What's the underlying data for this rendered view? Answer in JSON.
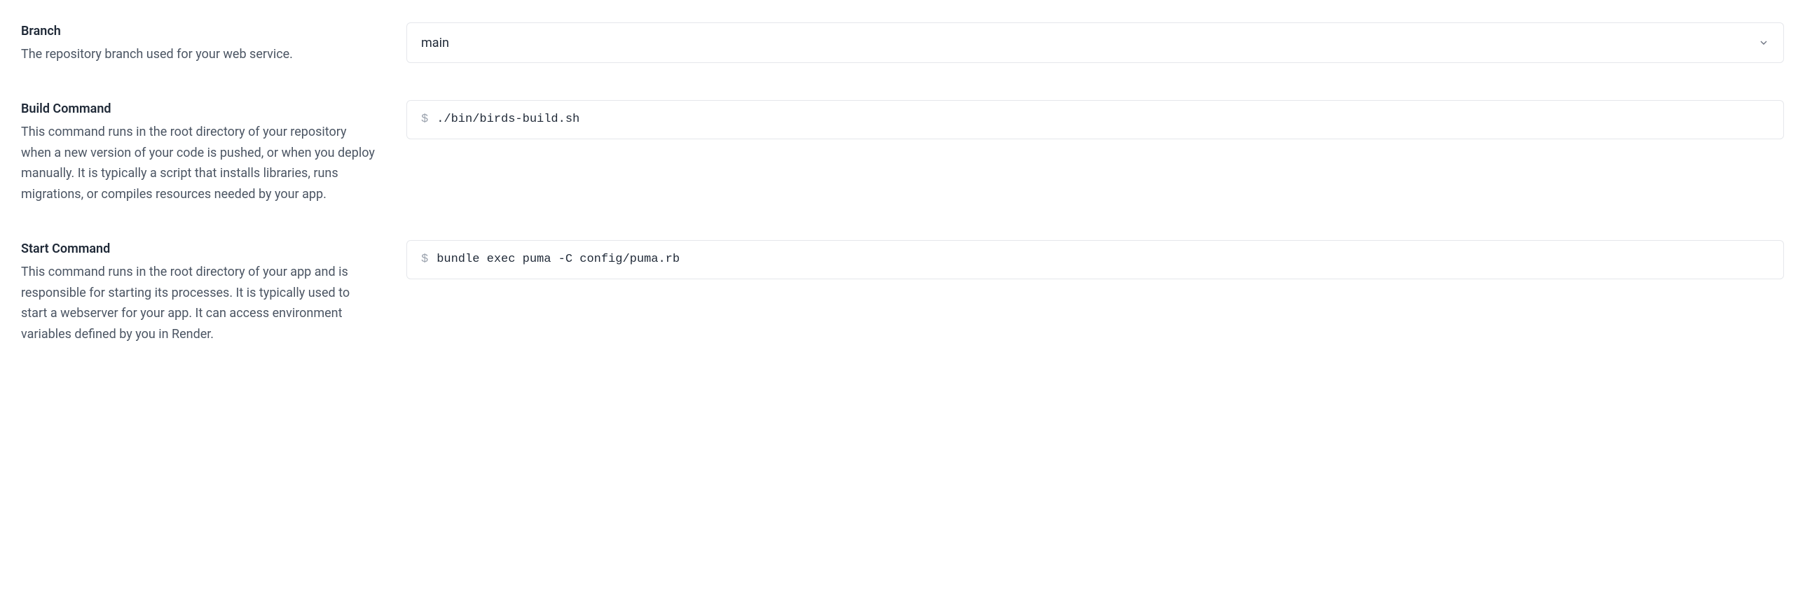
{
  "branch": {
    "title": "Branch",
    "description": "The repository branch used for your web service.",
    "selected": "main"
  },
  "buildCommand": {
    "title": "Build Command",
    "description": "This command runs in the root directory of your repository when a new version of your code is pushed, or when you deploy manually. It is typically a script that installs libraries, runs migrations, or compiles resources needed by your app.",
    "prefix": "$",
    "value": "./bin/birds-build.sh"
  },
  "startCommand": {
    "title": "Start Command",
    "description": "This command runs in the root directory of your app and is responsible for starting its processes. It is typically used to start a webserver for your app. It can access environment variables defined by you in Render.",
    "prefix": "$",
    "value": "bundle exec puma -C config/puma.rb"
  }
}
